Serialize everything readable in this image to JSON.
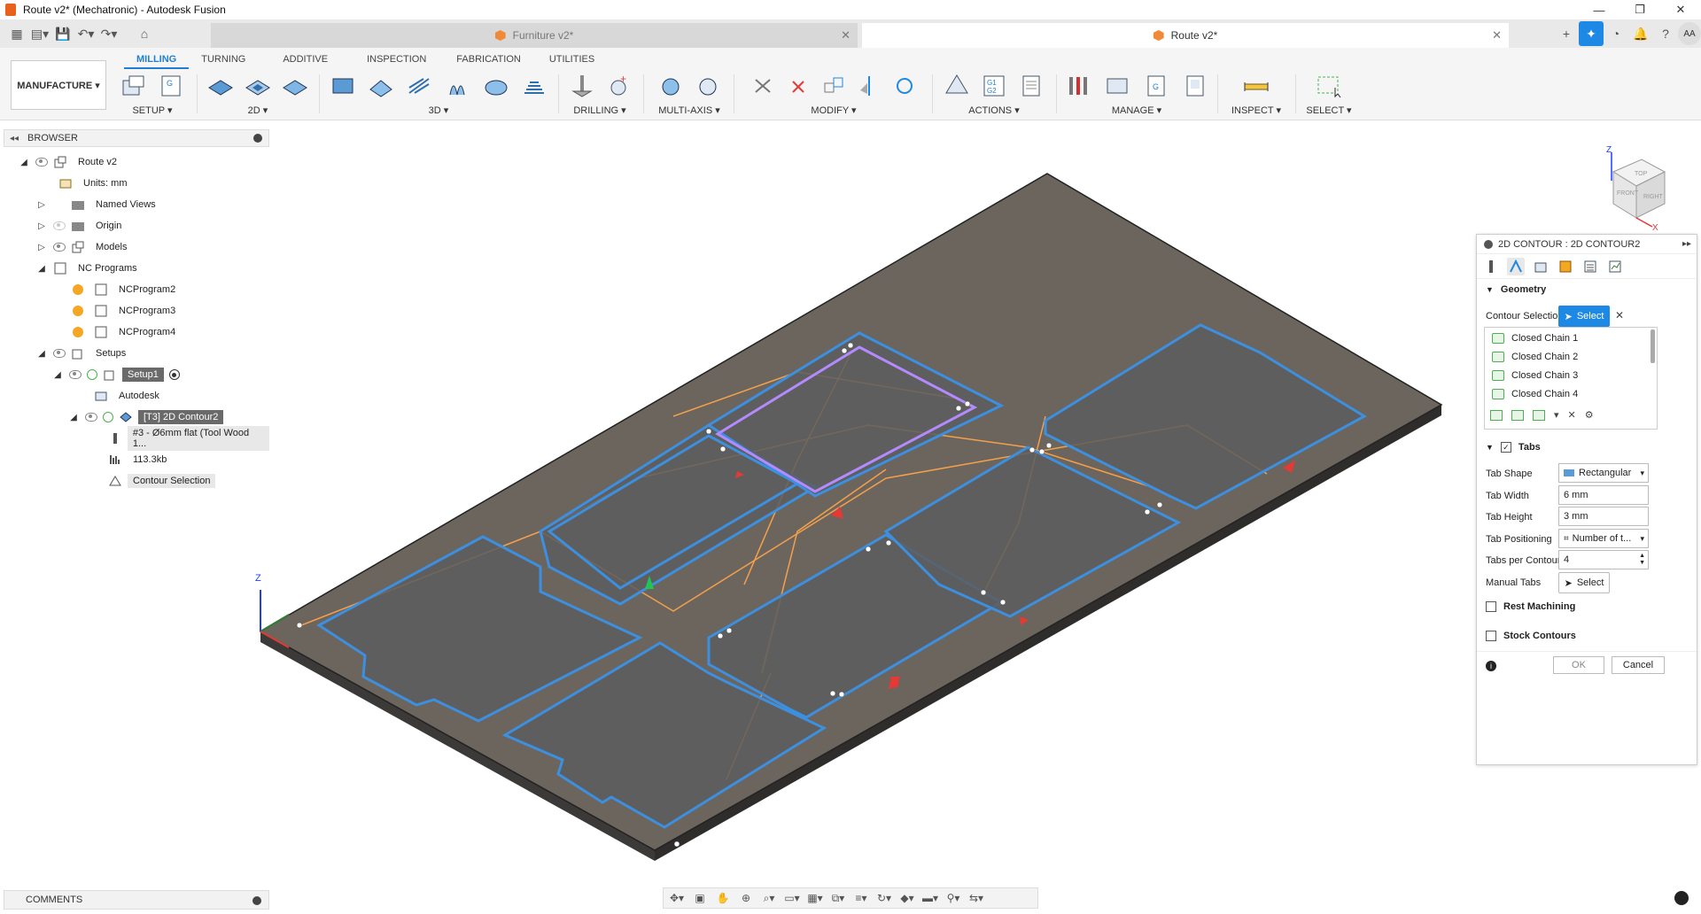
{
  "window": {
    "title": "Route v2* (Mechatronic) - Autodesk Fusion",
    "controls": [
      "—",
      "❐",
      "✕"
    ]
  },
  "tabs": [
    {
      "label": "Furniture v2*",
      "active": false
    },
    {
      "label": "Route v2*",
      "active": true
    }
  ],
  "user_initials": "AA",
  "workspace": "MANUFACTURE ▾",
  "ribbon_tabs": [
    "MILLING",
    "TURNING",
    "ADDITIVE",
    "INSPECTION",
    "FABRICATION",
    "UTILITIES"
  ],
  "ribbon_groups": {
    "setup": "SETUP ▾",
    "twod": "2D ▾",
    "threed": "3D ▾",
    "drilling": "DRILLING ▾",
    "multiaxis": "MULTI-AXIS ▾",
    "modify": "MODIFY ▾",
    "actions": "ACTIONS ▾",
    "manage": "MANAGE ▾",
    "inspect": "INSPECT ▾",
    "select": "SELECT ▾"
  },
  "browser": {
    "title": "BROWSER",
    "root": "Route v2",
    "units": "Units: mm",
    "named_views": "Named Views",
    "origin": "Origin",
    "models": "Models",
    "nc_programs": "NC Programs",
    "ncprogram2": "NCProgram2",
    "ncprogram3": "NCProgram3",
    "ncprogram4": "NCProgram4",
    "setups": "Setups",
    "setup1": "Setup1",
    "autodesk": "Autodesk",
    "contour_op": "[T3] 2D Contour2",
    "tool": "#3 - Ø6mm flat (Tool Wood 1...",
    "file_size": "113.3kb",
    "contour_selection": "Contour Selection"
  },
  "comments": "COMMENTS",
  "dialog": {
    "title": "2D CONTOUR : 2D CONTOUR2",
    "geometry": "Geometry",
    "contour_selection_label": "Contour Selection",
    "select_btn": "Select",
    "chains": [
      "Closed Chain 1",
      "Closed Chain 2",
      "Closed Chain 3",
      "Closed Chain 4"
    ],
    "tabs_section": "Tabs",
    "tab_shape_label": "Tab Shape",
    "tab_shape_value": "Rectangular",
    "tab_width_label": "Tab Width",
    "tab_width_value": "6 mm",
    "tab_height_label": "Tab Height",
    "tab_height_value": "3 mm",
    "tab_positioning_label": "Tab Positioning",
    "tab_positioning_value": "Number of t...",
    "tabs_per_contour_label": "Tabs per Contour",
    "tabs_per_contour_value": "4",
    "manual_tabs_label": "Manual Tabs",
    "manual_select": "Select",
    "rest_machining": "Rest Machining",
    "stock_contours": "Stock Contours",
    "ok": "OK",
    "cancel": "Cancel"
  },
  "viewcube": {
    "top": "TOP",
    "front": "FRONT",
    "right": "RIGHT",
    "z": "Z",
    "x": "X"
  },
  "axis": {
    "z": "Z"
  },
  "colors": {
    "accent": "#1e88e5",
    "toolpath_blue": "#3d8fe0",
    "lead_orange": "#f5a04a",
    "stock": "#5e5a55"
  }
}
